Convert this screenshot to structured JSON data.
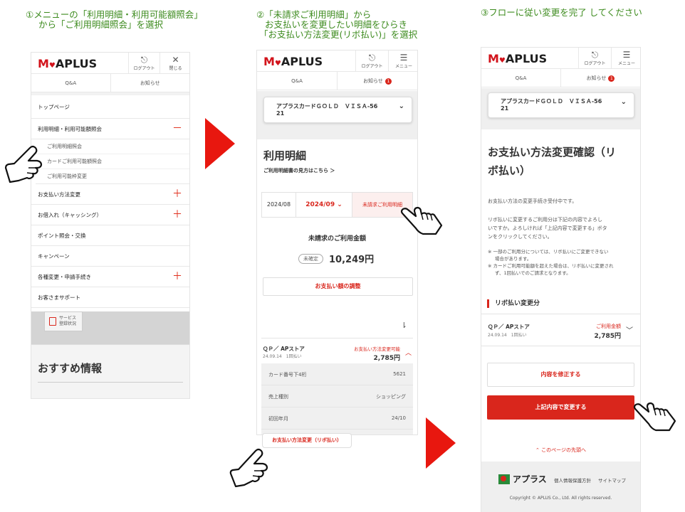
{
  "steps": {
    "s1": {
      "line1": "①メニューの「利用明細・利用可能額照会」",
      "line2": "から「ご利用明細照会」を選択"
    },
    "s2": {
      "line1": "②「未請求ご利用明細」から",
      "line2": "お支払いを変更したい明細をひらき",
      "line3": "「お支払い方法変更(リボ払い)」を選択"
    },
    "s3": {
      "line1": "③フローに従い変更を完了 してください"
    }
  },
  "header": {
    "logo_m": "M",
    "logo_rest": "APLUS",
    "logo_heart": "♥",
    "logout_label": "ログアウト",
    "close_label": "閉じる",
    "menu_label": "メニュー",
    "qa_tab": "Q&A",
    "notice_tab": "お知らせ",
    "notice_count": "1"
  },
  "menu": {
    "top": "トップページ",
    "meisai": "利用明細・利用可能額照会",
    "sub1": "ご利用明細照会",
    "sub2": "カードご利用可能額照会",
    "sub3": "ご利用可能枠変更",
    "payment": "お支払い方法変更",
    "cashing": "お借入れ（キャッシング）",
    "point": "ポイント照会・交換",
    "campaign": "キャンペーン",
    "change": "各種変更・申請手続き",
    "support": "お客さまサポート",
    "plus": "＋",
    "minus": "－",
    "service_line1": "サービス",
    "service_line2": "登録状況",
    "recommend": "おすすめ情報"
  },
  "card": {
    "line1": "アプラスカードＧＯＬＤ　ＶＩＳＡ-56",
    "line2": "21",
    "chevron": "⌄"
  },
  "meisai": {
    "title": "利用明細",
    "how_to": "ご利用明細書の見方はこちら ＞",
    "month_prev": "2024/08",
    "month_current": "2024/09 ⌄",
    "unbilled_tab": "未請求ご利用明細",
    "unbilled_heading": "未請求のご利用金額",
    "status_pill": "未確定",
    "amount": "10,249円",
    "adjust_button": "お支払い額の調整",
    "sort_icon": "⇂",
    "shop": "ＱＰ／ APストア",
    "date_type": "24.09.14　1回払い",
    "changeable": "お支払い方法変更可能",
    "price": "2,785円",
    "row1_label": "カード番号下4桁",
    "row1_value": "5621",
    "row2_label": "売上種別",
    "row2_value": "ショッピング",
    "row3_label": "初回年月",
    "row3_value": "24/10",
    "revo_button": "お支払い方法変更（リボ払い）"
  },
  "confirm": {
    "title_line1": "お支払い方法変更確認（リ",
    "title_line2": "ボ払い）",
    "accepting": "お支払い方法の変更手続き受付中です。",
    "para1": "リボ払いに変更するご利用分は下記の内容でよろし",
    "para2": "いですか。よろしければ「上記内容で変更する」ボタ",
    "para3": "ンをクリックしてください。",
    "note1a": "※ 一部のご利用分については、リボ払いにご変更できない",
    "note1b": "場合があります。",
    "note2a": "※ カードご利用可能額を超えた場合は、リボ払いに変更され",
    "note2b": "ず、1回払いでのご請求となります。",
    "section": "リボ払い変更分",
    "shop": "ＱＰ／ APストア",
    "date_type": "24.09.14　1回払い",
    "amount_label": "ご利用金額",
    "amount": "2,785円",
    "modify_button": "内容を修正する",
    "submit_button": "上記内容で変更する",
    "to_top": "⌃ このページの先頭へ",
    "footer_logo": "アプラス",
    "privacy": "個人情報保護方針",
    "sitemap": "サイトマップ",
    "copyright": "Copyright © APLUS Co., Ltd. All rights reserved."
  },
  "colors": {
    "brand_red": "#d9261c",
    "step_green": "#3d8b1e",
    "arrow_red": "#e8170f"
  }
}
